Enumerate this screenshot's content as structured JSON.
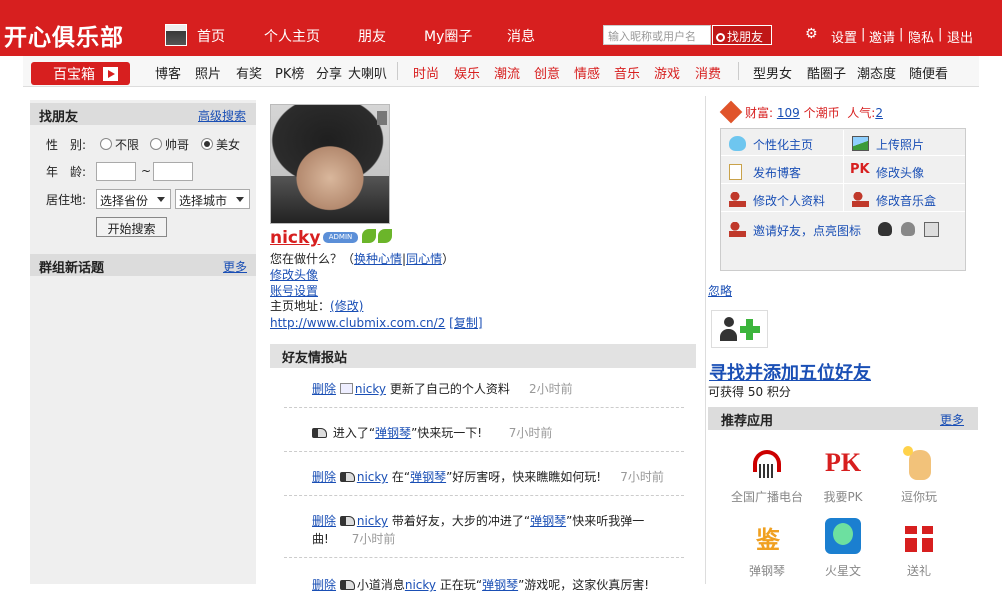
{
  "brand": {
    "logo": "开心俱乐部"
  },
  "topnav": {
    "items": [
      "首页",
      "个人主页",
      "朋友",
      "My圈子",
      "消息"
    ],
    "search_placeholder": "输入昵称或用户名",
    "find_label": "找朋友",
    "links": [
      "设置",
      "邀请",
      "隐私",
      "退出"
    ]
  },
  "subnav": {
    "treasure": "百宝箱",
    "group1": [
      "博客",
      "照片",
      "有奖",
      "PK榜",
      "分享",
      "大喇叭"
    ],
    "group2": [
      "时尚",
      "娱乐",
      "潮流",
      "创意",
      "情感",
      "音乐",
      "游戏",
      "消费"
    ],
    "group3": [
      "型男女",
      "酷圈子",
      "潮态度",
      "随便看"
    ]
  },
  "find_friends": {
    "title": "找朋友",
    "advanced": "高级搜索",
    "gender_label": "性　别:",
    "gender_options": [
      "不限",
      "帅哥",
      "美女"
    ],
    "gender_selected": "美女",
    "age_label": "年　龄:",
    "age_sep": "~",
    "location_label": "居住地:",
    "province": "选择省份",
    "city": "选择城市",
    "search_button": "开始搜索"
  },
  "group_topics": {
    "title": "群组新话题",
    "more": "更多"
  },
  "profile": {
    "username": "nicky",
    "admin": "ADMIN",
    "doing_label": "您在做什么？（",
    "change_mood": "换种心情",
    "same_mood": "同心情",
    "doing_close": "）",
    "edit_avatar": "修改头像",
    "account_settings": "账号设置",
    "homepage_label": "主页地址：",
    "homepage_edit": "(修改)",
    "homepage_url": "http://www.clubmix.com.cn/2",
    "copy": "[复制]"
  },
  "feed": {
    "title": "好友情报站",
    "delete_label": "删除",
    "rows": [
      {
        "user": "nicky",
        "text": "更新了自己的个人资料",
        "time": "2小时前"
      },
      {
        "pre": "进入了“",
        "game": "弹钢琴",
        "post": "”快来玩一下!",
        "time": "7小时前"
      },
      {
        "user": "nicky",
        "pre": "在“",
        "game": "弹钢琴",
        "post": "”好厉害呀，快来瞧瞧如何玩!",
        "time": "7小时前"
      },
      {
        "user": "nicky",
        "pre": "带着好友，大步的冲进了“",
        "game": "弹钢琴",
        "post": "”快来听我弹一",
        "post2": "曲!",
        "time": "7小时前"
      },
      {
        "pre": "小道消息",
        "user": "nicky",
        "mid": "正在玩“",
        "game": "弹钢琴",
        "post": "”游戏呢，这家伙真厉害!"
      }
    ]
  },
  "wealth": {
    "label": "财富:",
    "coins": "109",
    "coin_unit": "个潮币",
    "popularity_label": "人气:",
    "popularity": "2"
  },
  "quick_actions": [
    "个性化主页",
    "上传照片",
    "发布博客",
    "修改头像",
    "修改个人资料",
    "修改音乐盒",
    "邀请好友，点亮图标"
  ],
  "suggest": {
    "ignore": "忽略",
    "title": "寻找并添加五位好友",
    "points": "可获得 50 积分"
  },
  "apps": {
    "title": "推荐应用",
    "more": "更多",
    "items": [
      "全国广播电台",
      "我要PK",
      "逗你玩",
      "弹钢琴",
      "火星文",
      "送礼"
    ]
  },
  "colors": {
    "brand_red": "#d71f1f",
    "link_blue": "#1a4fb5"
  }
}
